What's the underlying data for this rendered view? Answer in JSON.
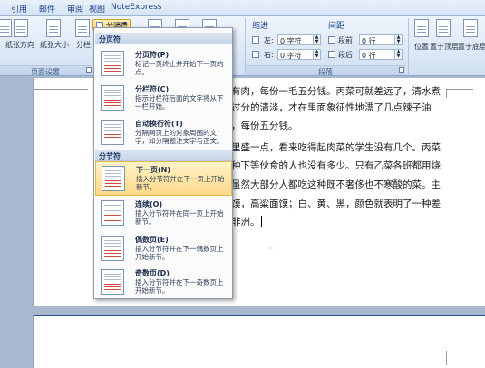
{
  "ribbon_tabs": [
    "引用",
    "邮件",
    "审阅",
    "视图",
    "NoteExpress"
  ],
  "ribbon": {
    "page_setup": {
      "buttons": [
        "纸张方向",
        "纸张大小",
        "分栏"
      ],
      "group_label": "页面设置",
      "breaks_button": "分隔符"
    },
    "indent": {
      "title": "缩进",
      "left_label": "左:",
      "left_value": "0 字符",
      "right_label": "右:",
      "right_value": "0 字符"
    },
    "spacing": {
      "title": "间距",
      "before_label": "段前:",
      "before_value": "0 行",
      "after_label": "段后:",
      "after_value": "0 行"
    },
    "paragraph_group_label": "段落",
    "arrange_buttons": [
      "位置",
      "置于顶层",
      "置于底层"
    ]
  },
  "breaks_menu": {
    "page_breaks_header": "分页符",
    "section_breaks_header": "分节符",
    "page_items": [
      {
        "title": "分页符(P)",
        "desc": "标记一页终止并开始下一页的点。"
      },
      {
        "title": "分栏符(C)",
        "desc": "指示分栏符后面的文字将从下一栏开始。"
      },
      {
        "title": "自动换行符(T)",
        "desc": "分隔网页上的对象周围的文字，如分隔题注文字与正文。"
      }
    ],
    "section_items": [
      {
        "title": "下一页(N)",
        "desc": "插入分节符并在下一页上开始新节。",
        "highlighted": true
      },
      {
        "title": "连续(O)",
        "desc": "插入分节符并在同一页上开始新节。"
      },
      {
        "title": "偶数页(E)",
        "desc": "插入分节符并在下一偶数页上开始新节。"
      },
      {
        "title": "奇数页(D)",
        "desc": "插入分节符并在下一奇数页上开始新节。"
      }
    ]
  },
  "document": {
    "lines": [
      "有肉，每份一毛五分钱。丙菜可就差远了，清水煮",
      "过分的清淡，才在里面象征性地漂了几点辣子油",
      "，每份五分钱。",
      "里盛一点，看来吃得起肉菜的学生没有几个。丙菜",
      "种下等伙食的人也没有多少。只有乙菜各班都用烧",
      "虽然大部分人都吃这种既不奢侈也不寒酸的菜。主",
      "馍，高粱面馍；白、黄、黑，颜色就表明了一种差",
      "非洲。"
    ]
  }
}
